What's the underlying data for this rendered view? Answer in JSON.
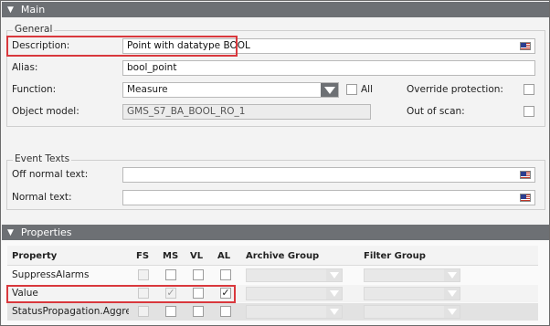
{
  "main_section": {
    "title": "Main"
  },
  "general": {
    "title": "General",
    "description": {
      "label": "Description:",
      "value": "Point with datatype BOOL"
    },
    "alias": {
      "label": "Alias:",
      "value": "bool_point"
    },
    "function": {
      "label": "Function:",
      "value": "Measure",
      "all_label": "All"
    },
    "object_model": {
      "label": "Object model:",
      "value": "GMS_S7_BA_BOOL_RO_1"
    },
    "override_protection": {
      "label": "Override protection:"
    },
    "out_of_scan": {
      "label": "Out of scan:"
    }
  },
  "event_texts": {
    "title": "Event Texts",
    "off_normal": {
      "label": "Off normal text:",
      "value": ""
    },
    "normal": {
      "label": "Normal text:",
      "value": ""
    }
  },
  "properties_section": {
    "title": "Properties"
  },
  "properties_table": {
    "headers": {
      "property": "Property",
      "fs": "FS",
      "ms": "MS",
      "vl": "VL",
      "al": "AL",
      "archive_group": "Archive Group",
      "filter_group": "Filter Group"
    },
    "rows": [
      {
        "property": "SuppressAlarms",
        "fs": false,
        "ms": false,
        "vl": false,
        "al": false
      },
      {
        "property": "Value",
        "fs": false,
        "ms": true,
        "vl": false,
        "al": true
      },
      {
        "property": "StatusPropagation.Aggregate",
        "fs": false,
        "ms": false,
        "vl": false,
        "al": false
      }
    ]
  },
  "check_glyph": "✓"
}
